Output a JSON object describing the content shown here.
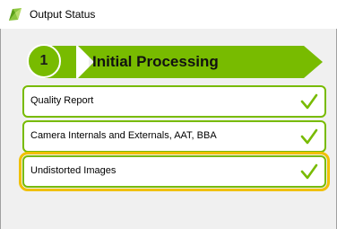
{
  "window": {
    "title": "Output Status",
    "icon": "app-logo-icon"
  },
  "step": {
    "number": "1",
    "title": "Initial Processing",
    "color": "#78bb00"
  },
  "items": [
    {
      "label": "Quality Report",
      "status_icon": "check-icon",
      "selected": false
    },
    {
      "label": "Camera Internals and Externals, AAT, BBA",
      "status_icon": "check-icon",
      "selected": false
    },
    {
      "label": "Undistorted Images",
      "status_icon": "check-icon",
      "selected": true
    }
  ],
  "colors": {
    "accent": "#78bb00",
    "selection": "#f0c000"
  }
}
